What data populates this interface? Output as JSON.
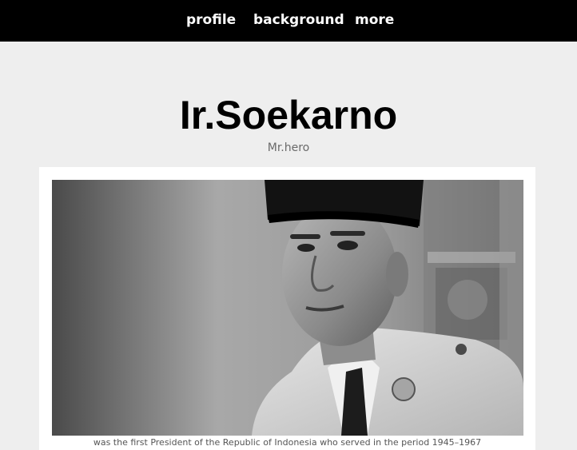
{
  "nav": {
    "items": [
      {
        "label": "profile"
      },
      {
        "label": "background"
      },
      {
        "label": "more"
      }
    ]
  },
  "header": {
    "title": "Ir.Soekarno",
    "subtitle": "Mr.hero"
  },
  "card": {
    "photo_subject": "portrait photo of Soekarno in black peci cap and white uniform",
    "caption": "was the first President of the Republic of Indonesia who served in the period 1945–1967"
  },
  "colors": {
    "navbar": "#000000",
    "nav_text": "#ffffff",
    "page_background": "#eeeeee",
    "card_background": "#ffffff",
    "title": "#000000",
    "subtitle": "#6a6a6a",
    "caption": "#555555"
  }
}
